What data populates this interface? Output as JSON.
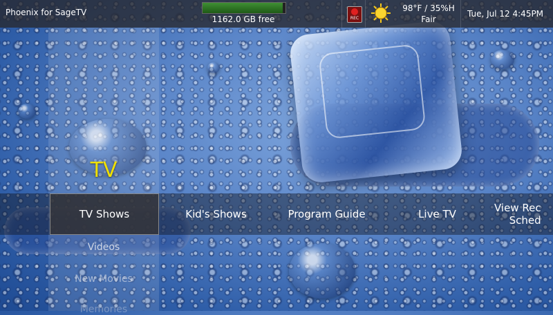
{
  "app_title": "Phoenix for SageTV",
  "disk": {
    "free_text": "1162.0 GB free",
    "used_fraction": 0.97
  },
  "rec_label": "REC",
  "weather": {
    "temp_humidity": "98°F / 35%H",
    "condition": "Fair",
    "icon": "sun-icon"
  },
  "datetime": "Tue, Jul 12 4:45PM",
  "section": {
    "title": "TV"
  },
  "menu": {
    "items": [
      {
        "label": "TV Shows",
        "selected": true
      },
      {
        "label": "Kid's Shows"
      },
      {
        "label": "Program Guide"
      },
      {
        "label": "Live TV"
      },
      {
        "label": "View Rec\nSched"
      }
    ],
    "sub_items": [
      {
        "label": "Videos"
      },
      {
        "label": "New Movies"
      },
      {
        "label": "Memories"
      }
    ]
  },
  "colors": {
    "accent": "#f0e000",
    "disk_fill": "#3f8f34",
    "rec": "#e02020"
  }
}
